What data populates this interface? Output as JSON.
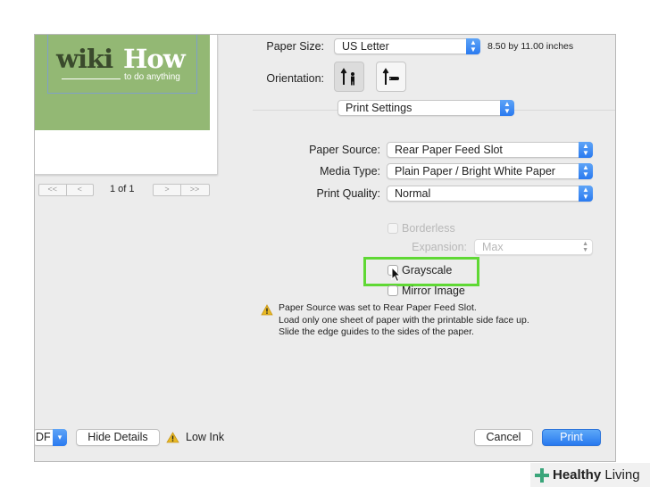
{
  "preview": {
    "logo_wiki": "wiki",
    "logo_how": "How",
    "logo_tagline": "to do anything",
    "pager_first": "<<",
    "pager_prev": "<",
    "page_count": "1 of 1",
    "pager_next": ">",
    "pager_last": ">>"
  },
  "settings": {
    "paper_size_label": "Paper Size:",
    "paper_size_value": "US Letter",
    "paper_size_dims": "8.50 by 11.00 inches",
    "orientation_label": "Orientation:",
    "section_value": "Print Settings",
    "paper_source_label": "Paper Source:",
    "paper_source_value": "Rear Paper Feed Slot",
    "media_type_label": "Media Type:",
    "media_type_value": "Plain Paper / Bright White Paper",
    "print_quality_label": "Print Quality:",
    "print_quality_value": "Normal",
    "borderless_label": "Borderless",
    "expansion_label": "Expansion:",
    "expansion_value": "Max",
    "grayscale_label": "Grayscale",
    "mirror_label": "Mirror Image"
  },
  "notice": {
    "line1": "Paper Source was set to Rear Paper Feed Slot.",
    "line2": "Load only one sheet of paper with the printable side face up.",
    "line3": "Slide the edge guides to the sides of the paper."
  },
  "footer": {
    "pdf_label": "DF",
    "hide_details": "Hide Details",
    "low_ink": "Low Ink",
    "cancel": "Cancel",
    "print": "Print"
  },
  "watermark": {
    "brand_bold": "Healthy",
    "brand_light": " Living"
  },
  "colors": {
    "accent": "#2a7af0",
    "highlight": "#5fd834",
    "logo_green": "#93b874",
    "warning": "#e8b923"
  }
}
